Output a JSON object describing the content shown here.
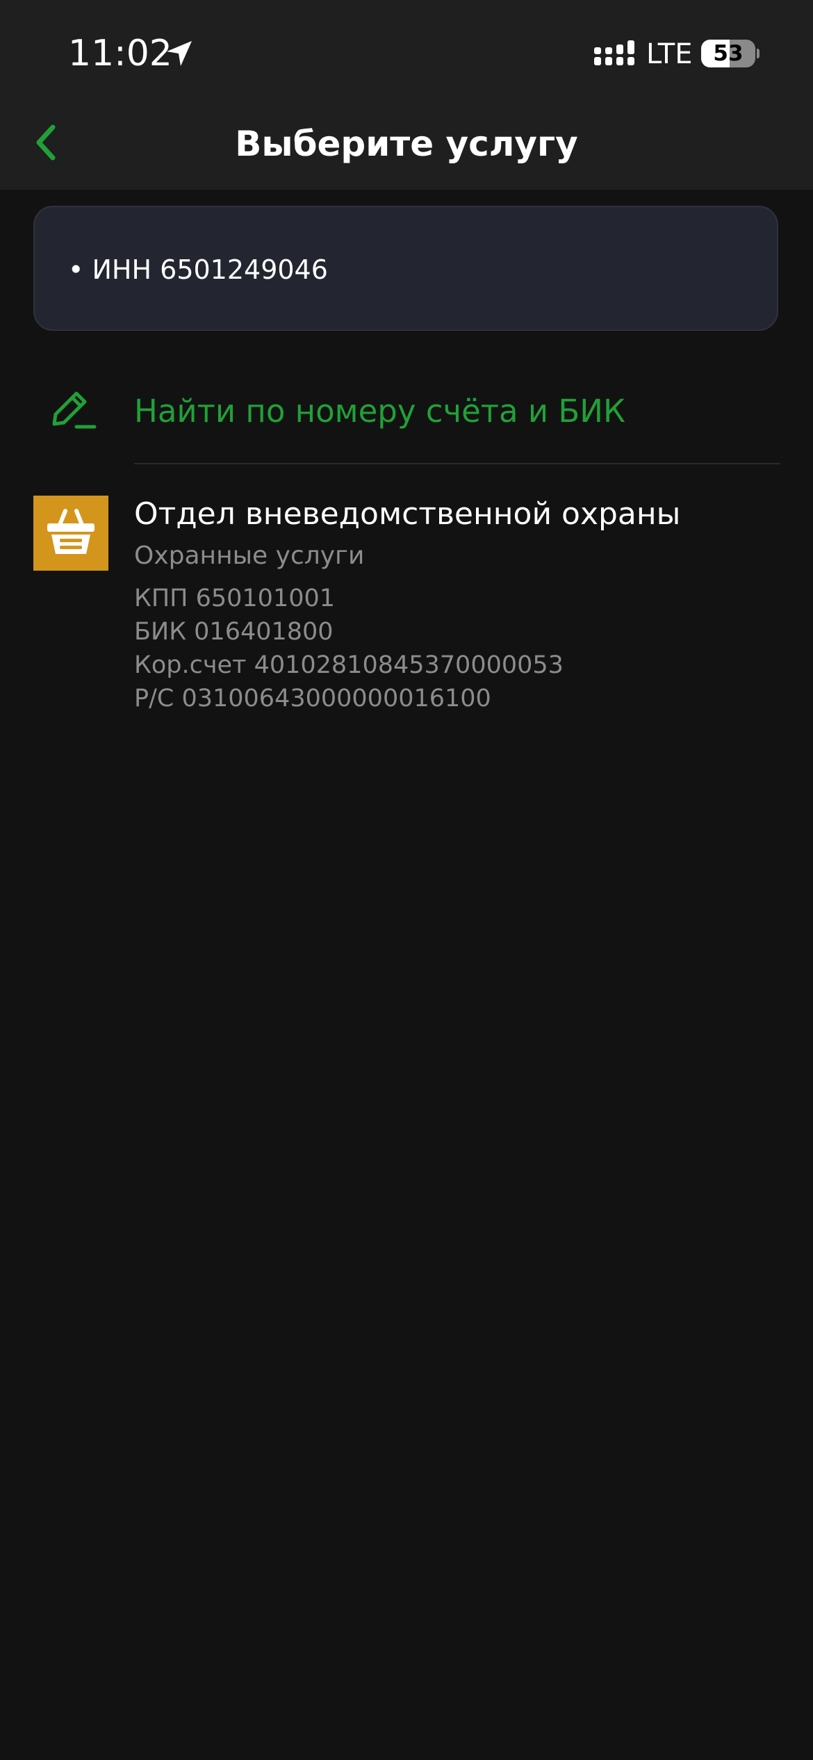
{
  "status_bar": {
    "time": "11:02",
    "network": "LTE",
    "battery_level": "53",
    "battery_fraction": 0.53,
    "icons": [
      "location-arrow-icon",
      "signal-icon",
      "battery-icon"
    ]
  },
  "nav": {
    "title": "Выберите услугу",
    "back_icon": "chevron-left-icon"
  },
  "inn_card": {
    "text": "• ИНН 6501249046"
  },
  "find_by_account": {
    "label": "Найти по номеру счёта и БИК",
    "icon": "pencil-icon"
  },
  "services": [
    {
      "name": "Отдел вневедомственной охраны",
      "category": "Охранные услуги",
      "kpp": "КПП 650101001",
      "bik": "БИК 016401800",
      "corr_account": "Кор.счет 40102810845370000053",
      "account": "Р/С 03100643000000016100",
      "icon": "basket-icon"
    }
  ],
  "colors": {
    "accent": "#21a038",
    "background": "#121212",
    "header": "#1f1f1f",
    "card": "#232630",
    "service_logo": "#d4951c",
    "secondary_text": "#8c8c8c"
  }
}
